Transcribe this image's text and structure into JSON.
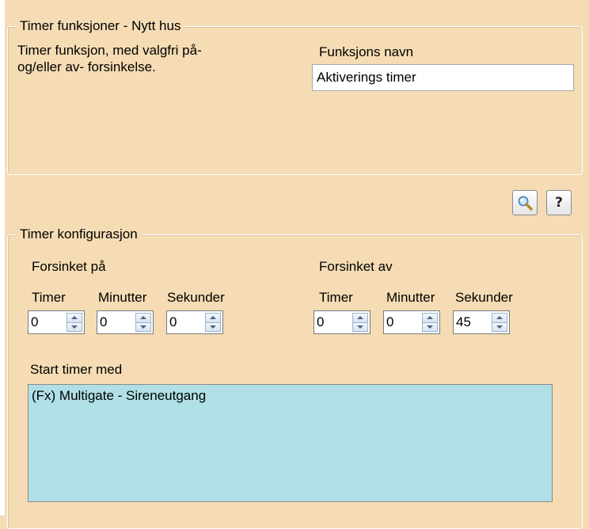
{
  "function_group": {
    "title": "Timer funksjoner - Nytt hus",
    "description_line1": "Timer funksjon, med valgfri på-",
    "description_line2": "og/eller av- forsinkelse.",
    "name_label": "Funksjons navn",
    "name_value": "Aktiverings timer"
  },
  "toolbar": {
    "search_icon": "magnifier-icon",
    "help_label": "?"
  },
  "config_group": {
    "title": "Timer konfigurasjon",
    "delay_on": {
      "label": "Forsinket på",
      "hours_label": "Timer",
      "minutes_label": "Minutter",
      "seconds_label": "Sekunder",
      "hours": "0",
      "minutes": "0",
      "seconds": "0"
    },
    "delay_off": {
      "label": "Forsinket av",
      "hours_label": "Timer",
      "minutes_label": "Minutter",
      "seconds_label": "Sekunder",
      "hours": "0",
      "minutes": "0",
      "seconds": "45"
    },
    "start_label": "Start timer med",
    "start_items": [
      "(Fx) Multigate - Sireneutgang"
    ],
    "list_color": "#b0dfe6"
  }
}
